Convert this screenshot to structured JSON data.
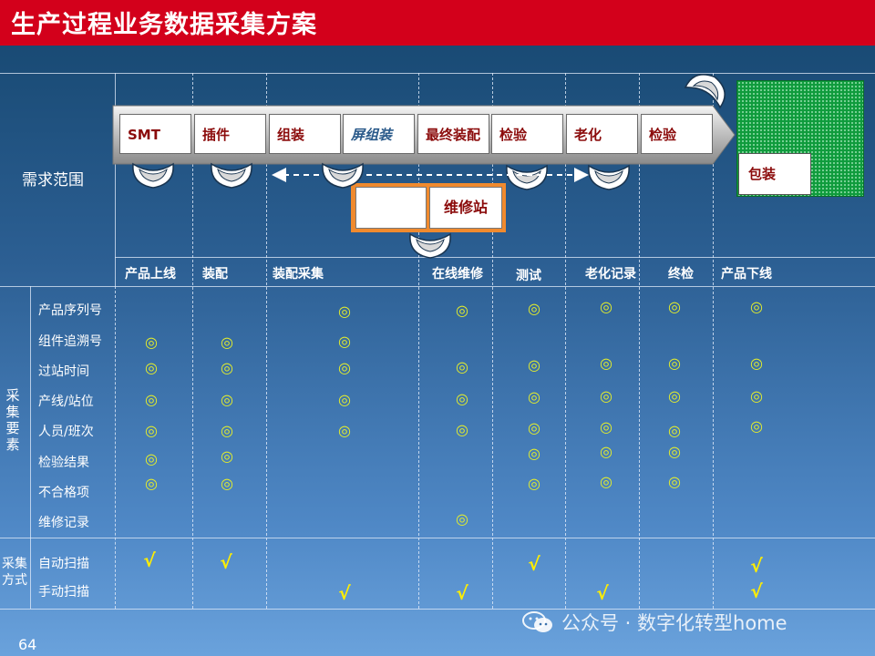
{
  "title": "生产过程业务数据采集方案",
  "scope_label": "需求范围",
  "group_labels": {
    "factors": "采集要素",
    "methods": "采集方式"
  },
  "process_steps": [
    "SMT",
    "插件",
    "组装",
    "屏组装",
    "最终装配",
    "检验",
    "老化",
    "检验"
  ],
  "packing_label": "包装",
  "repair_label": "维修站",
  "phases": [
    "产品上线",
    "装配",
    "装配采集",
    "在线维修",
    "测试",
    "老化记录",
    "终检",
    "产品下线"
  ],
  "factors": [
    "产品序列号",
    "组件追溯号",
    "过站时间",
    "产线/站位",
    "人员/班次",
    "检验结果",
    "不合格项",
    "维修记录"
  ],
  "methods": [
    "自动扫描",
    "手动扫描"
  ],
  "mark_symbol": "◎",
  "check_symbol": "√",
  "page_number": "64",
  "watermark": "公众号 · 数字化转型home",
  "colors": {
    "title_bar": "#d3001b",
    "mark": "#e6ef2a",
    "check": "#ffee00",
    "packing_area": "#0f9b3c",
    "repair_frame": "#f08a2e",
    "step_text": "#8b0b0b"
  }
}
